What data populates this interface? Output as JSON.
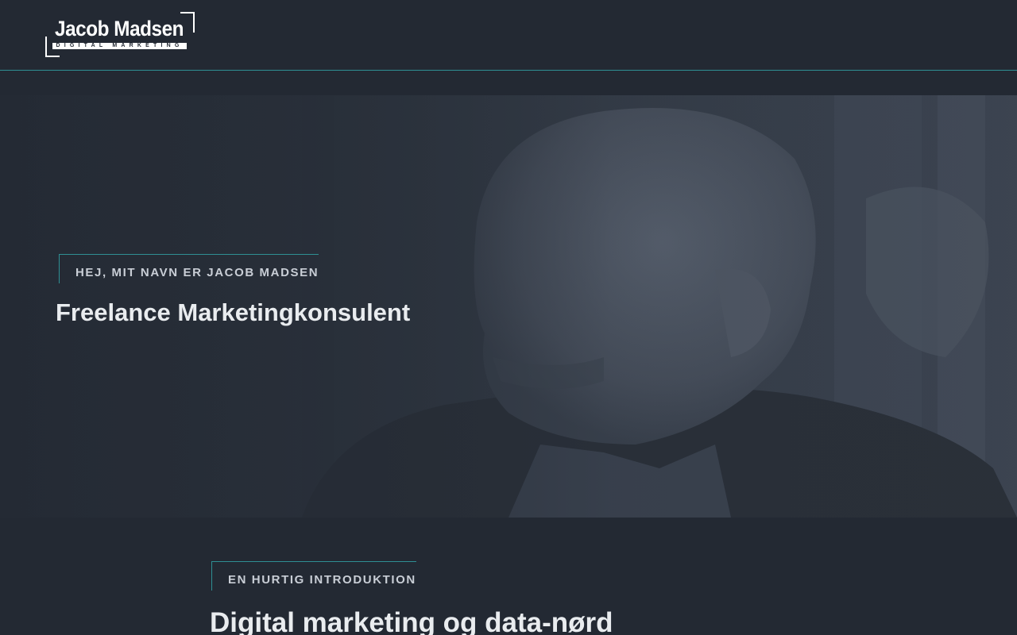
{
  "header": {
    "logo": {
      "name": "Jacob Madsen",
      "tagline": "DIGITAL MARKETING"
    }
  },
  "hero": {
    "eyebrow": "HEJ, MIT NAVN ER JACOB MADSEN",
    "title": "Freelance Marketingkonsulent",
    "photo": "portrait-photo"
  },
  "intro": {
    "eyebrow": "EN HURTIG INTRODUKTION",
    "title": "Digital marketing og data-nørd"
  },
  "colors": {
    "background": "#232933",
    "accent": "#2f8f93",
    "text": "#e9ecef"
  }
}
